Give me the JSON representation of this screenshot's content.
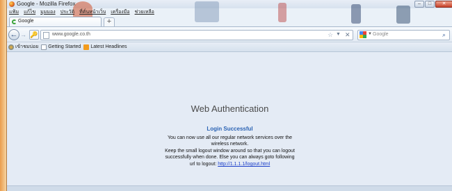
{
  "window": {
    "title": "Google - Mozilla Firefox",
    "minimize_glyph": "–",
    "maximize_glyph": "□",
    "close_glyph": "✕"
  },
  "menu": [
    "แฟ้ม",
    "แก้ไข",
    "มุมมอง",
    "ประวัติ",
    "ที่คั่นหน้าเว็บ",
    "เครื่องมือ",
    "ช่วยเหลือ"
  ],
  "tabs": [
    {
      "label": "Google"
    }
  ],
  "newtab_glyph": "+",
  "navbar": {
    "back_glyph": "←",
    "forward_glyph": "→",
    "identity_glyph": "🔑",
    "url": "www.google.co.th",
    "star_glyph": "☆",
    "dropdown_glyph": "▼",
    "stop_glyph": "✕",
    "search_placeholder": "Google",
    "search_dropdown_glyph": "▼",
    "search_glyph": "⌕"
  },
  "bookmarks": [
    {
      "label": "เข้าชมบ่อย",
      "icon": "most-visited-icon"
    },
    {
      "label": "Getting Started",
      "icon": "page-icon"
    },
    {
      "label": "Latest Headlines",
      "icon": "rss-feed-icon"
    }
  ],
  "page": {
    "heading": "Web Authentication",
    "login_title": "Login Successful",
    "line1": "You can now use all our regular network services over the",
    "line2": "wireless network.",
    "line3": "Keep the small logout window around so that you can logout",
    "line4": "successfully when done. Else you can always goto following",
    "line5_prefix": "url to logout:",
    "logout_url": "http://1.1.1.1/logout.html"
  },
  "colors": {
    "firefox_orange": "#e1651c",
    "link_blue": "#1a3ec9",
    "title_blue": "#2b63b4",
    "content_bg": "#e4ebf5"
  }
}
